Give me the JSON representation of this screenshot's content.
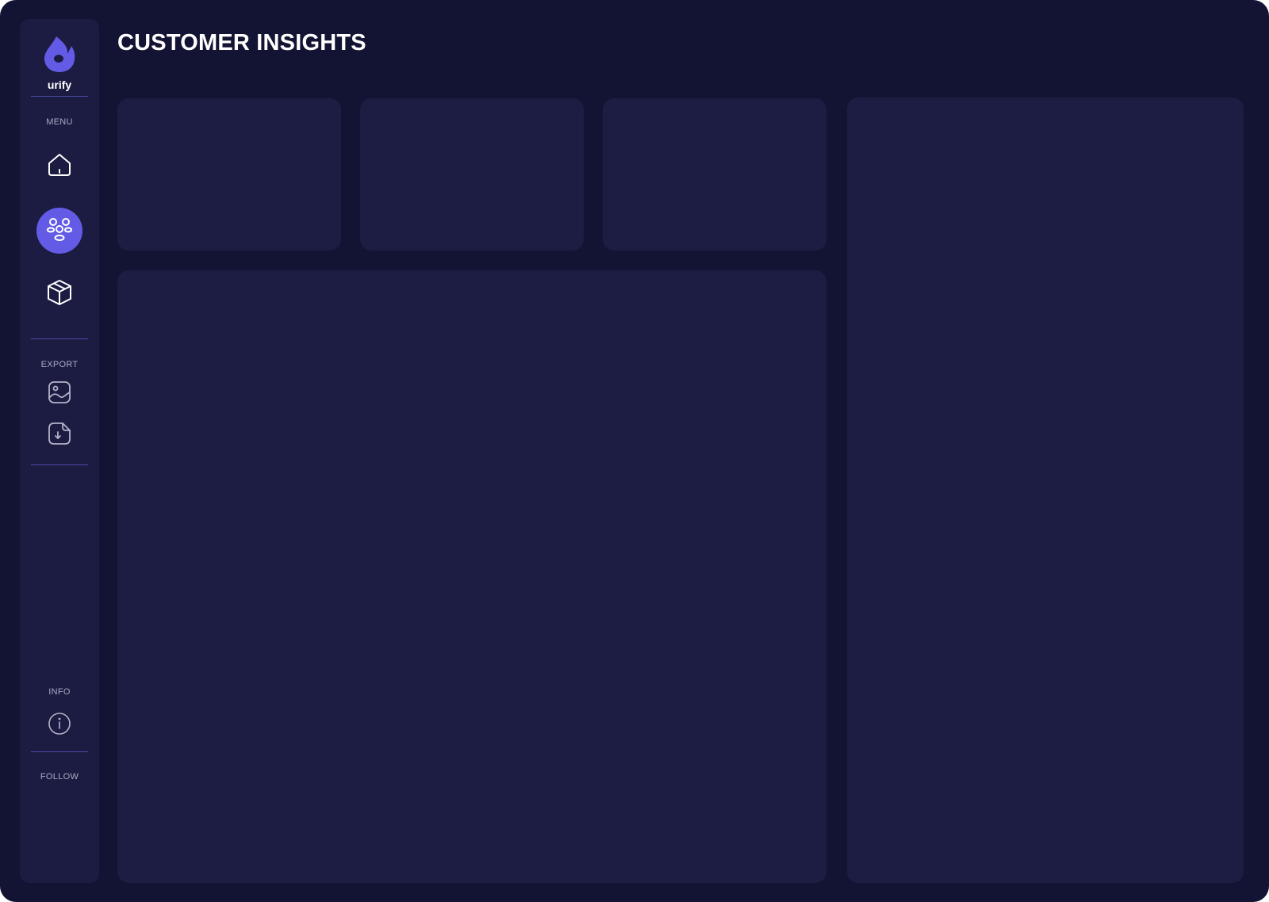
{
  "app": {
    "brand": "urify",
    "page_title": "CUSTOMER INSIGHTS",
    "accent_color": "#635be6"
  },
  "sidebar": {
    "menu_label": "MENU",
    "menu_items": [
      {
        "icon": "home-icon",
        "active": false
      },
      {
        "icon": "customers-icon",
        "active": true
      },
      {
        "icon": "package-icon",
        "active": false
      }
    ],
    "export_label": "EXPORT",
    "export_items": [
      {
        "icon": "image-export-icon"
      },
      {
        "icon": "file-download-icon"
      }
    ],
    "info_label": "INFO",
    "info_icon": "info-icon",
    "follow_label": "FOLLOW"
  },
  "cards": [
    {
      "name": "stat-card-1"
    },
    {
      "name": "stat-card-2"
    },
    {
      "name": "stat-card-3"
    },
    {
      "name": "main-panel"
    },
    {
      "name": "side-panel"
    }
  ]
}
